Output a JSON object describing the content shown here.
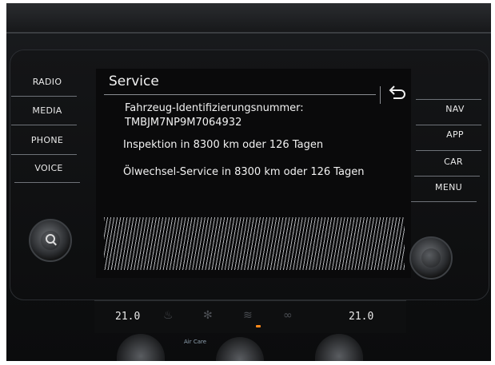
{
  "left_menu": [
    {
      "label": "RADIO"
    },
    {
      "label": "MEDIA"
    },
    {
      "label": "PHONE"
    },
    {
      "label": "VOICE"
    }
  ],
  "right_menu": [
    {
      "label": "NAV"
    },
    {
      "label": "APP"
    },
    {
      "label": "CAR"
    },
    {
      "label": "MENU"
    }
  ],
  "screen": {
    "title": "Service",
    "vin_label": "Fahrzeug-Identifizierungsnummer:",
    "vin": "TMBJM7NP9M7064932",
    "inspection": "Inspektion in 8300 km oder 126 Tagen",
    "oil_service": "Ölwechsel-Service in 8300 km oder 126 Tagen"
  },
  "climate": {
    "left_temp": "21.0",
    "right_temp": "21.0",
    "air_care_label": "Air Care"
  },
  "icons": [
    "back-icon",
    "volume-knob-icon",
    "tune-knob-icon"
  ],
  "colors": {
    "screen_text": "#f2f2f2",
    "indicator_led": "#ff8a1a"
  }
}
